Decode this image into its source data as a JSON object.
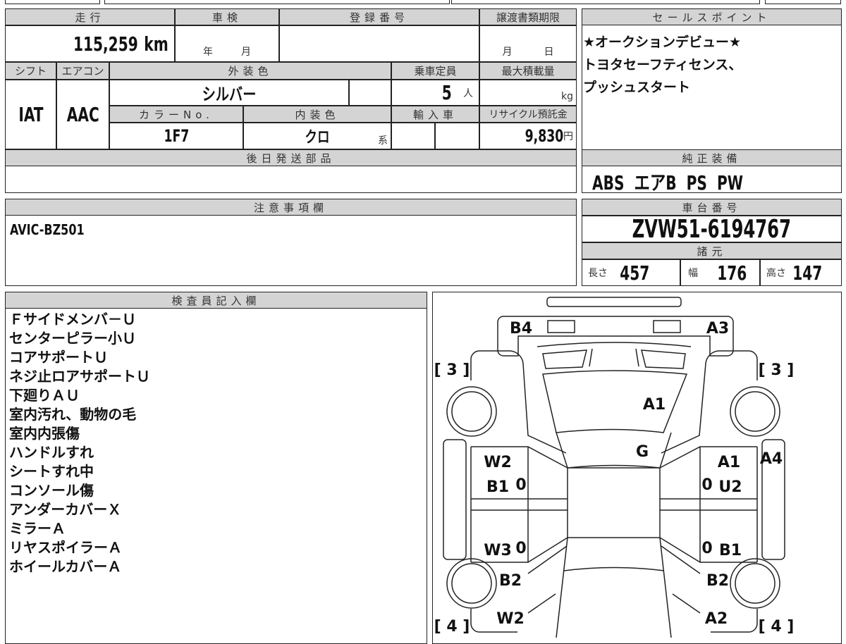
{
  "headers": {
    "mileage": "走行",
    "inspection": "車検",
    "registration": "登録番号",
    "transfer": "譲渡書類期限",
    "shift": "シフト",
    "aircon": "エアコン",
    "exterior": "外装色",
    "capacity": "乗車定員",
    "max_load": "最大積載量",
    "color_no": "カラーNo.",
    "interior": "内装色",
    "import": "輸入車",
    "recycle": "リサイクル預託金",
    "parts": "後日発送部品",
    "sales": "セールスポイント",
    "equipment": "純正装備",
    "notes": "注意事項欄",
    "chassis": "車台番号",
    "specs": "諸元",
    "inspector": "検査員記入欄"
  },
  "values": {
    "mileage": "115,259",
    "mileage_unit": "km",
    "insp_year": "年",
    "insp_month": "月",
    "transfer_month": "月",
    "transfer_day": "日",
    "shift": "IAT",
    "aircon": "AAC",
    "exterior": "シルバー",
    "capacity": "5",
    "capacity_unit": "人",
    "load_unit": "kg",
    "color_no": "1F7",
    "interior": "クロ",
    "interior_suffix": "系",
    "recycle": "9,830",
    "recycle_unit": "円"
  },
  "sales_points": [
    "★オークションデビュー★",
    "トヨタセーフティセンス、",
    "プッシュスタート"
  ],
  "equipment": "ABS  エアB  PS  PW",
  "notes": "AVIC-BZ501",
  "chassis_no": "ZVW51-6194767",
  "specs": {
    "length_label": "長さ",
    "length": "457",
    "width_label": "幅",
    "width": "176",
    "height_label": "高さ",
    "height": "147"
  },
  "inspector_items": [
    "Ｆサイドメンバ－Ｕ",
    "センターピラー小Ｕ",
    "コアサポートＵ",
    "ネジ止ロアサポートＵ",
    "下廻りＡＵ",
    "室内汚れ、動物の毛",
    "室内内張傷",
    "ハンドルすれ",
    "シートすれ中",
    "コンソール傷",
    "アンダーカバーＸ",
    "ミラーＡ",
    "リヤスポイラーＡ",
    "ホイールカバーＡ"
  ],
  "diagram_labels": {
    "b4": "B4",
    "a3": "A3",
    "lf_tire": "[ 3 ]",
    "rf_tire": "[ 3 ]",
    "hood": "A1",
    "windshield": "G",
    "lf_door": "W2",
    "lf_door2": "B1",
    "rf_door": "A1",
    "rf_door2": "U2",
    "r_rocker": "A4",
    "lr_door": "W3",
    "rr_door": "B1",
    "lr_qtr": "B2",
    "rr_qtr": "B2",
    "lr_qtr2": "W2",
    "rr_qtr2": "A2",
    "lr_tire": "[ 4 ]",
    "rr_tire": "[ 4 ]",
    "zero": "0"
  }
}
